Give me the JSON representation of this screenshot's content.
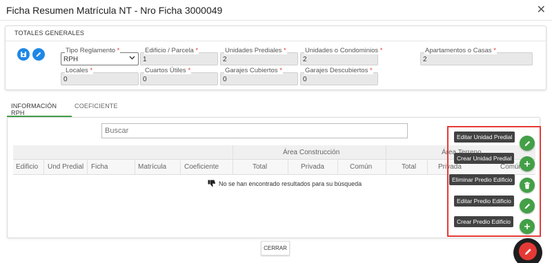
{
  "header": {
    "title": "Ficha Resumen Matrícula NT - Nro Ficha 3000049",
    "close": "✕"
  },
  "totales": {
    "title": "TOTALES GENERALES",
    "fields_row1": [
      {
        "label": "Tipo Reglamento",
        "value": "RPH",
        "select": true
      },
      {
        "label": "Edificio / Parcela",
        "value": "1"
      },
      {
        "label": "Unidades Prediales",
        "value": "2"
      },
      {
        "label": "Unidades o Condominios",
        "value": "2"
      },
      {
        "label": "Apartamentos o Casas",
        "value": "2"
      }
    ],
    "fields_row2": [
      {
        "label": "Locales",
        "value": "0"
      },
      {
        "label": "Cuartos Útiles",
        "value": "0"
      },
      {
        "label": "Garajes Cubiertos",
        "value": "0"
      },
      {
        "label": "Garajes Descubiertos",
        "value": "0"
      }
    ],
    "required_mark": "*"
  },
  "tabs": [
    {
      "label": "INFORMACIÓN RPH",
      "active": true
    },
    {
      "label": "COEFICIENTE",
      "active": false
    }
  ],
  "table": {
    "search_placeholder": "Buscar",
    "group_headers": [
      "Área Construcción",
      "Área Terreno"
    ],
    "columns": [
      "Edificio",
      "Und Predial",
      "Ficha",
      "Matrícula",
      "Coeficiente",
      "Total",
      "Privada",
      "Común",
      "Total",
      "Privada",
      "Común"
    ],
    "empty_message": "No se han encontrado resultados para su búsqueda"
  },
  "fab_actions": [
    {
      "tooltip": "Editar Unidad Predial",
      "icon": "pencil-icon"
    },
    {
      "tooltip": "Crear Unidad Predial",
      "icon": "plus-icon"
    },
    {
      "tooltip": "Eliminar Predio Edificio",
      "icon": "trash-icon"
    },
    {
      "tooltip": "Editar Predio Edificio",
      "icon": "pencil-icon"
    },
    {
      "tooltip": "Crear Predio Edificio",
      "icon": "plus-icon"
    }
  ],
  "footer": {
    "close_label": "CERRAR"
  },
  "colors": {
    "accent_green": "#43a047",
    "highlight_red": "#e53935",
    "icon_blue": "#1e88e5"
  }
}
